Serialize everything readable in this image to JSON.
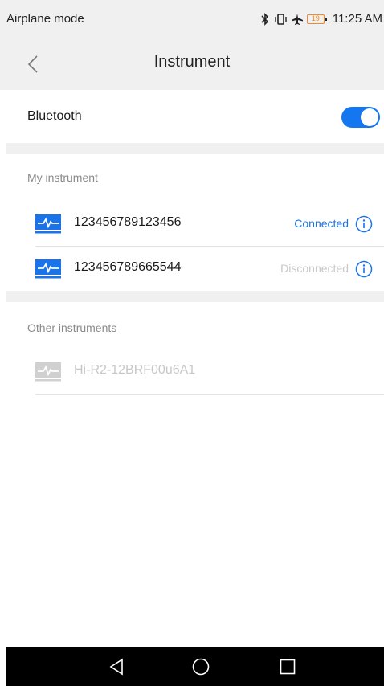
{
  "status_bar": {
    "left_text": "Airplane mode",
    "icons": [
      "bluetooth-icon",
      "vibrate-icon",
      "airplane-icon"
    ],
    "battery_level": "19",
    "time": "11:25 AM"
  },
  "app_bar": {
    "title": "Instrument"
  },
  "bluetooth": {
    "label": "Bluetooth",
    "enabled": true
  },
  "my_instruments": {
    "header": "My instrument",
    "items": [
      {
        "name": "123456789123456",
        "status": "Connected",
        "status_color": "#1a73e8"
      },
      {
        "name": "123456789665544",
        "status": "Disconnected",
        "status_color": "#c8c8c8"
      }
    ]
  },
  "other_instruments": {
    "header": "Other instruments",
    "items": [
      {
        "name": "Hi-R2-12BRF00u6A1"
      }
    ]
  },
  "colors": {
    "accent": "#1477ef",
    "background_gray": "#f0f0f0"
  }
}
